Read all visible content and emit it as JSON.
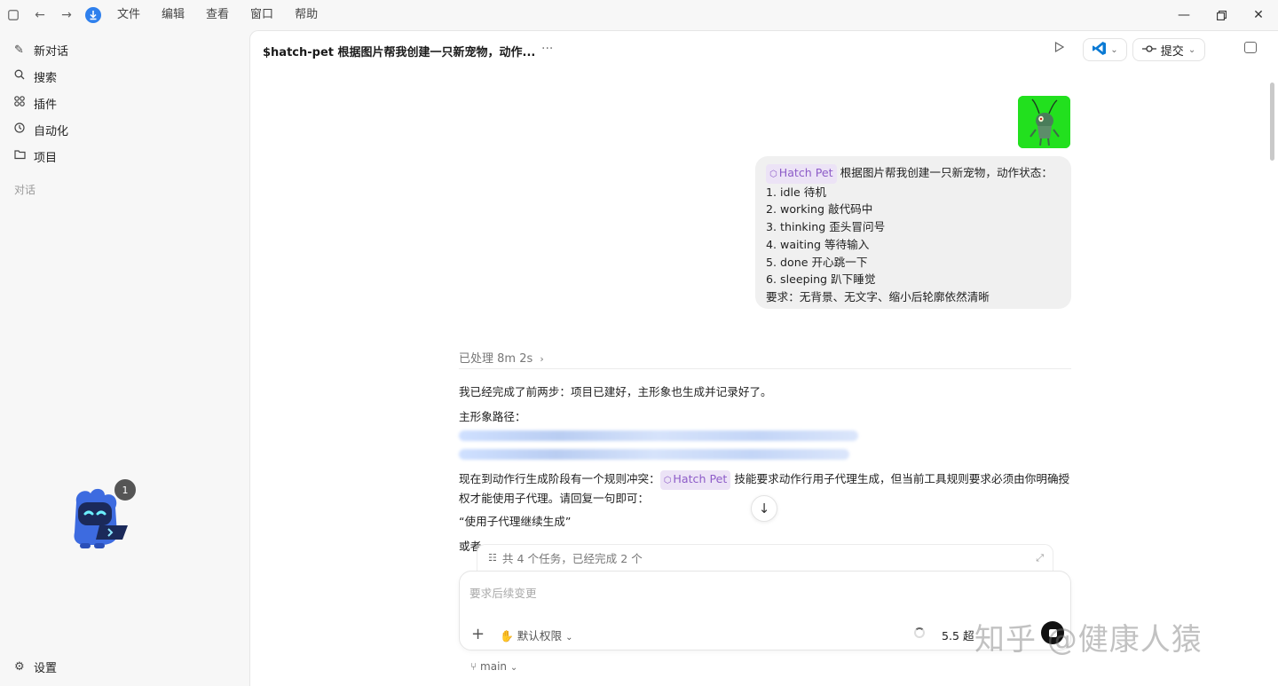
{
  "menu": [
    "文件",
    "编辑",
    "查看",
    "窗口",
    "帮助"
  ],
  "sidebar": {
    "items": [
      {
        "label": "新对话",
        "icon": "edit-icon"
      },
      {
        "label": "搜索",
        "icon": "search-icon"
      },
      {
        "label": "插件",
        "icon": "grid-icon"
      },
      {
        "label": "自动化",
        "icon": "clock-icon"
      },
      {
        "label": "项目",
        "icon": "folder-icon"
      }
    ],
    "section_label": "对话",
    "settings_label": "设置",
    "pet_badge": "1"
  },
  "header": {
    "title": "$hatch-pet 根据图片帮我创建一只新宠物，动作...",
    "more": "···",
    "commit_label": "提交"
  },
  "user_message": {
    "skill": "Hatch Pet",
    "intro": "根据图片帮我创建一只新宠物，动作状态：",
    "lines": [
      "1. idle 待机",
      "2. working 敲代码中",
      "3. thinking 歪头冒问号",
      "4. waiting 等待输入",
      "5. done 开心跳一下",
      "6. sleeping 趴下睡觉",
      "要求：无背景、无文字、缩小后轮廓依然清晰"
    ]
  },
  "assistant": {
    "processed": "已处理 8m 2s",
    "p1": "我已经完成了前两步：项目已建好，主形象也生成并记录好了。",
    "path_label": "主形象路径：",
    "p2_before": "现在到动作行生成阶段有一个规则冲突：",
    "skill": "Hatch Pet",
    "p2_after": "技能要求动作行用子代理生成，但当前工具规则要求必须由你明确授权才能使用子代理。请回复一句即可：",
    "quote": "“使用子代理继续生成”",
    "or": "或者"
  },
  "task_bar": "共 4 个任务，已经完成 2 个",
  "composer": {
    "placeholder": "要求后续变更",
    "permission": "默认权限",
    "model": "5.5 超"
  },
  "branch": "main",
  "watermark": "知乎 @健康人猿"
}
